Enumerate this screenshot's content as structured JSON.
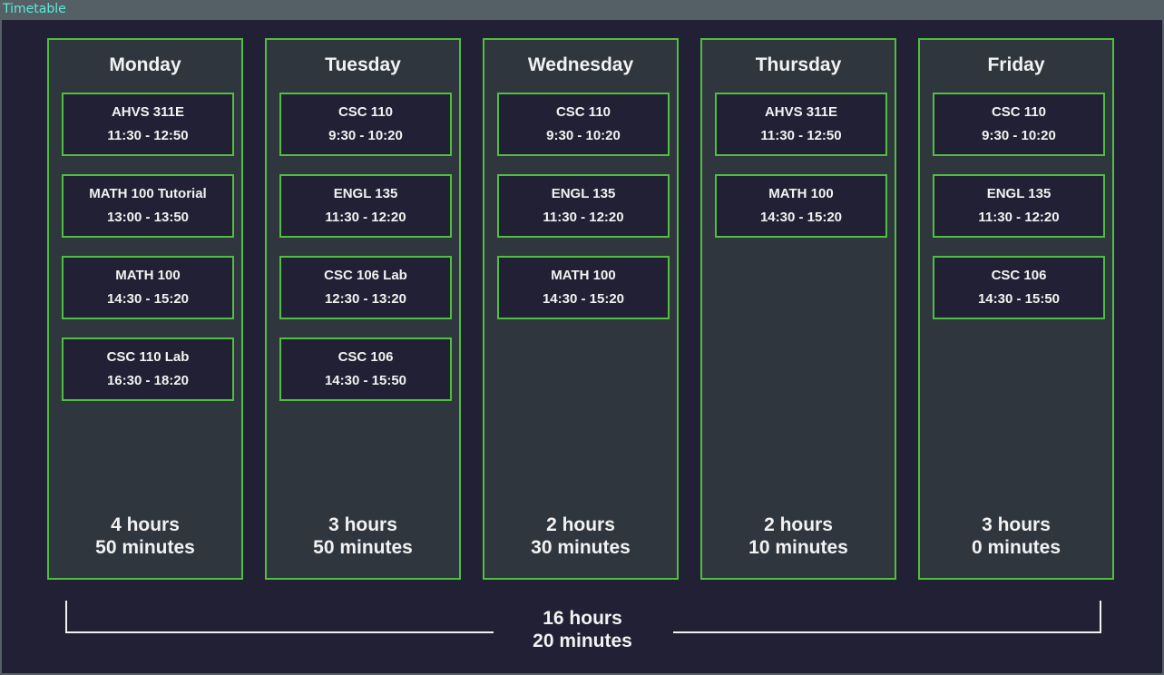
{
  "window": {
    "title": "Timetable"
  },
  "days": [
    {
      "name": "Monday",
      "courses": [
        {
          "name": "AHVS 311E",
          "time": "11:30 - 12:50"
        },
        {
          "name": "MATH 100 Tutorial",
          "time": "13:00 - 13:50"
        },
        {
          "name": "MATH 100",
          "time": "14:30 - 15:20"
        },
        {
          "name": "CSC 110 Lab",
          "time": "16:30 - 18:20"
        }
      ],
      "total_hours": "4 hours",
      "total_minutes": "50 minutes"
    },
    {
      "name": "Tuesday",
      "courses": [
        {
          "name": "CSC 110",
          "time": "9:30 - 10:20"
        },
        {
          "name": "ENGL 135",
          "time": "11:30 - 12:20"
        },
        {
          "name": "CSC 106 Lab",
          "time": "12:30 - 13:20"
        },
        {
          "name": "CSC 106",
          "time": "14:30 - 15:50"
        }
      ],
      "total_hours": "3 hours",
      "total_minutes": "50 minutes"
    },
    {
      "name": "Wednesday",
      "courses": [
        {
          "name": "CSC 110",
          "time": "9:30 - 10:20"
        },
        {
          "name": "ENGL 135",
          "time": "11:30 - 12:20"
        },
        {
          "name": "MATH 100",
          "time": "14:30 - 15:20"
        }
      ],
      "total_hours": "2 hours",
      "total_minutes": "30 minutes"
    },
    {
      "name": "Thursday",
      "courses": [
        {
          "name": "AHVS 311E",
          "time": "11:30 - 12:50"
        },
        {
          "name": "MATH 100",
          "time": "14:30 - 15:20"
        }
      ],
      "total_hours": "2 hours",
      "total_minutes": "10 minutes"
    },
    {
      "name": "Friday",
      "courses": [
        {
          "name": "CSC 110",
          "time": "9:30 - 10:20"
        },
        {
          "name": "ENGL 135",
          "time": "11:30 - 12:20"
        },
        {
          "name": "CSC 106",
          "time": "14:30 - 15:50"
        }
      ],
      "total_hours": "3 hours",
      "total_minutes": "0 minutes"
    }
  ],
  "week_total": {
    "hours": "16 hours",
    "minutes": "20 minutes"
  },
  "colors": {
    "background": "#222034",
    "column": "#30363e",
    "accent_border": "#4fbf3f",
    "text": "#f2f2f2",
    "titlebar_text": "#5fe8d8"
  }
}
